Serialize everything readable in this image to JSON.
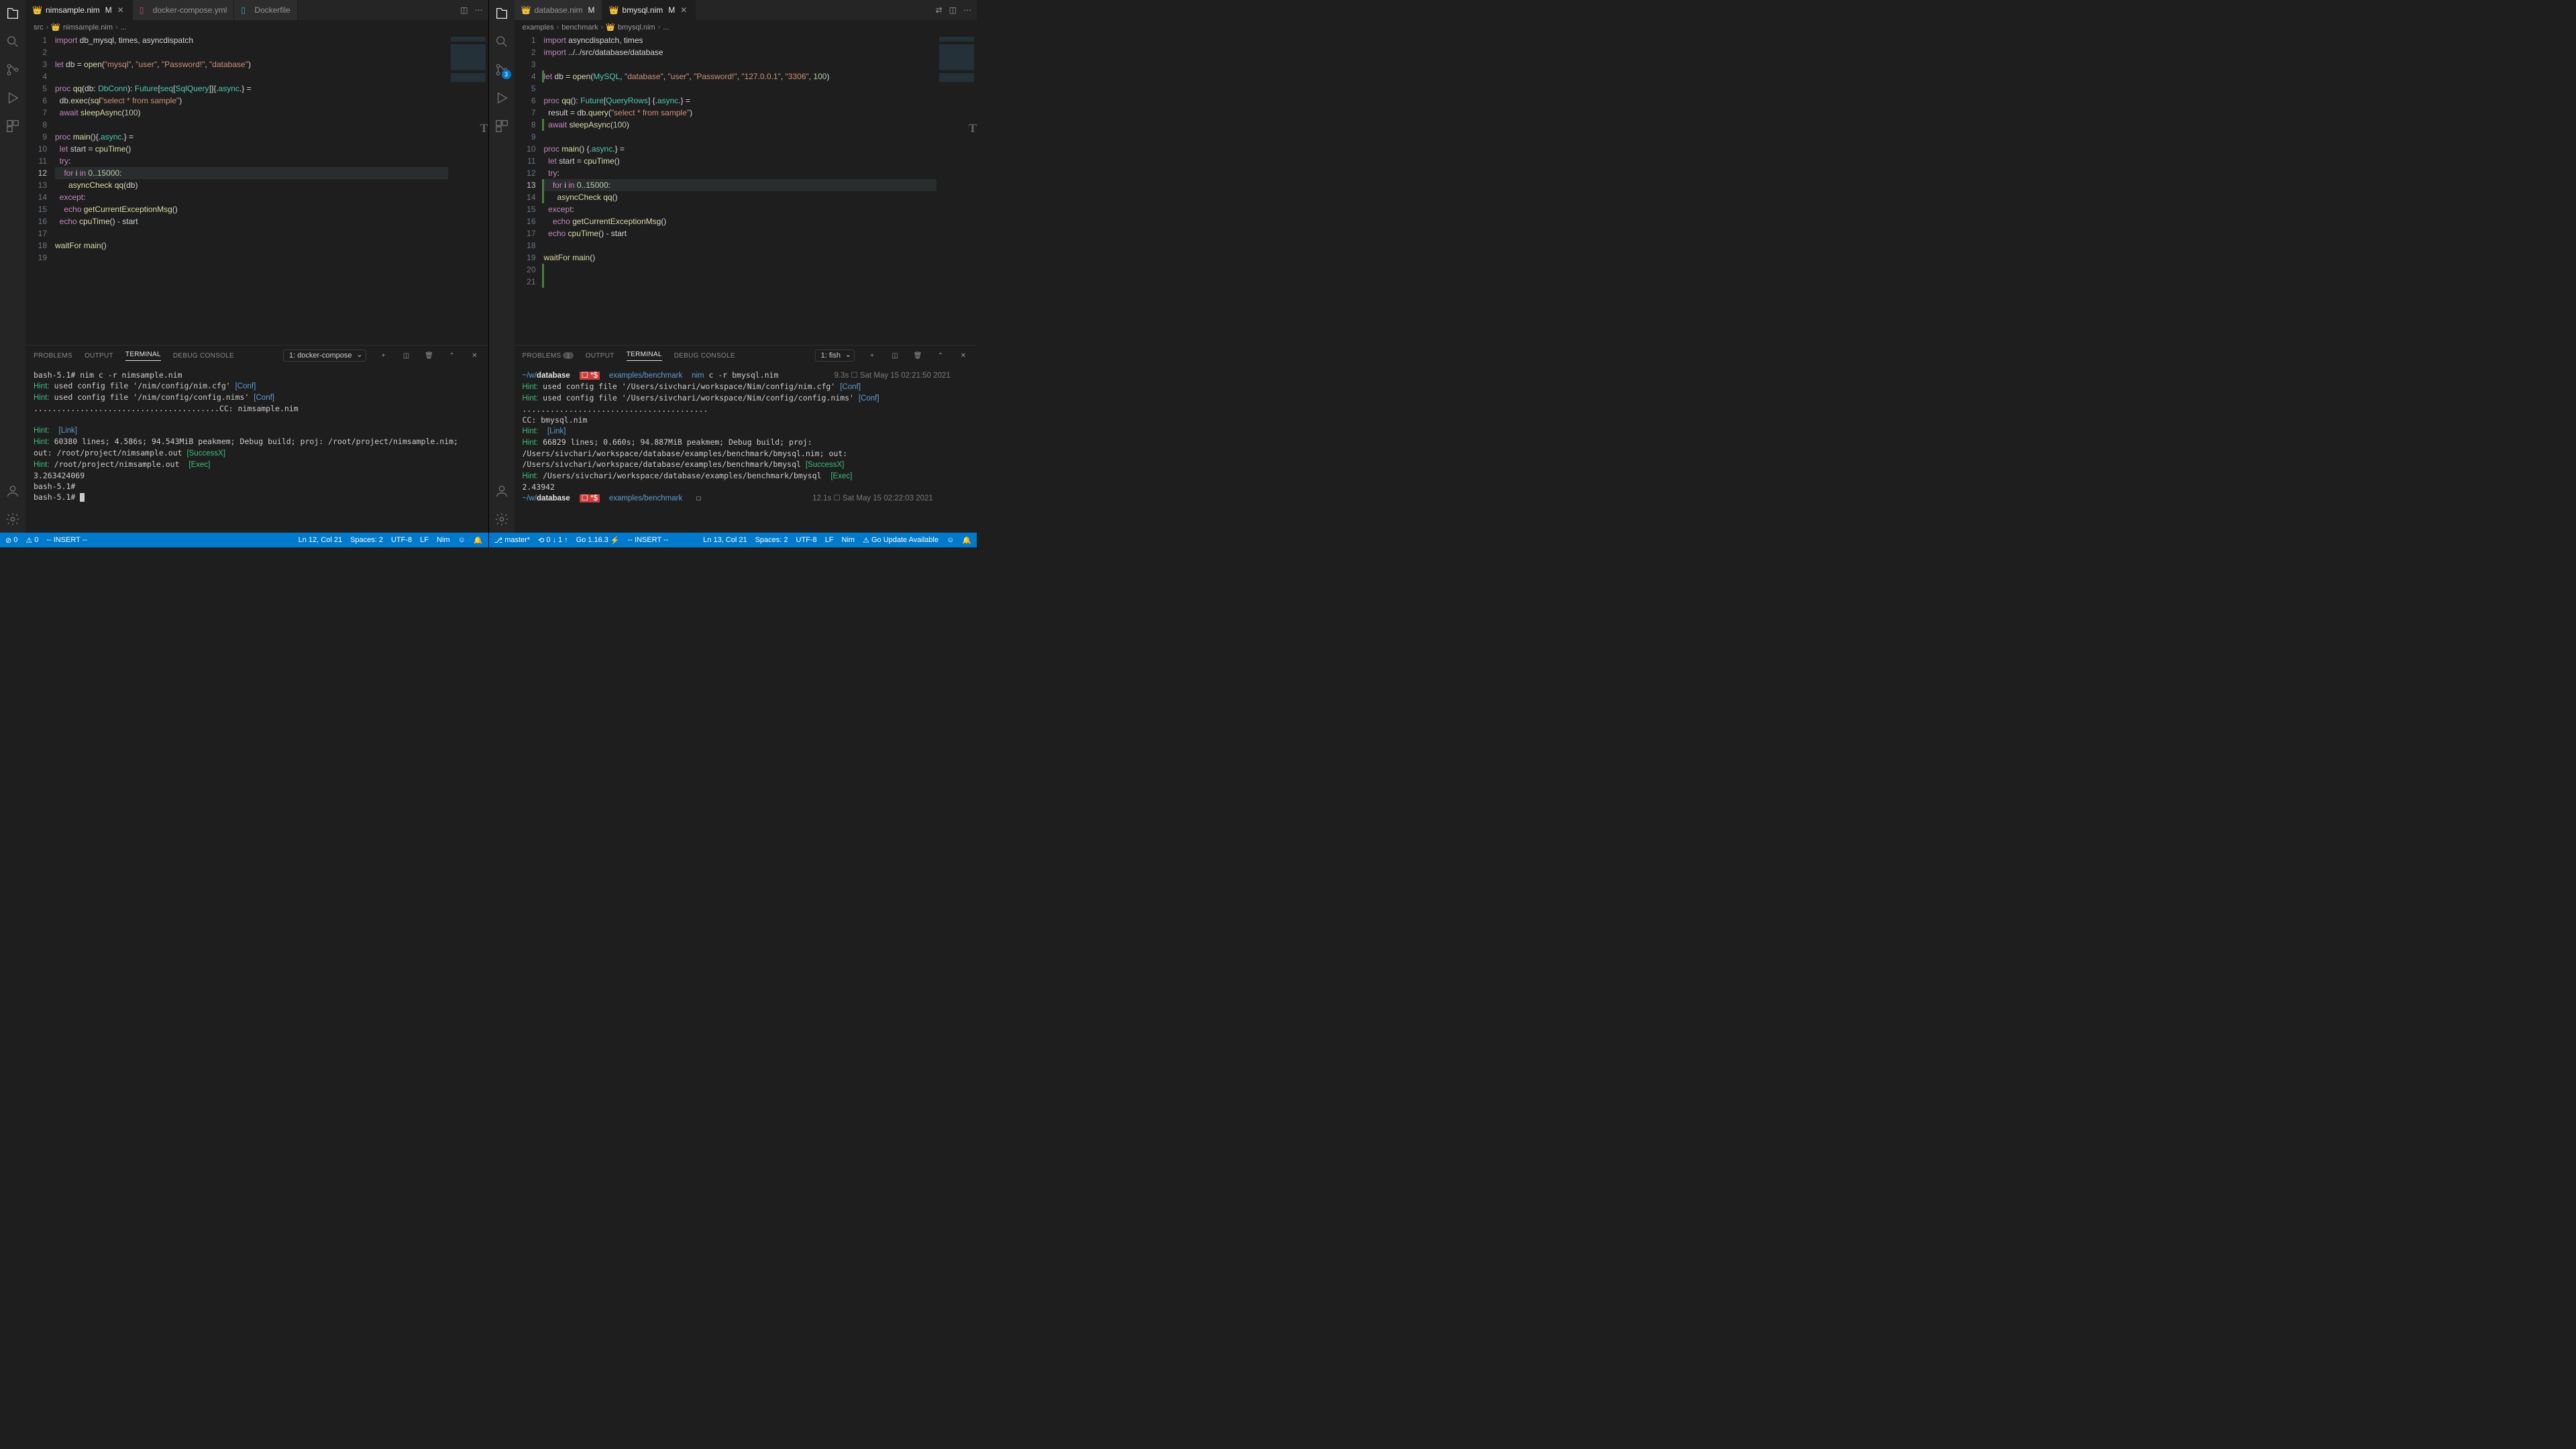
{
  "left": {
    "tabs": [
      {
        "name": "nimsample.nim",
        "status": "M",
        "active": true
      },
      {
        "name": "docker-compose.yml",
        "active": false
      },
      {
        "name": "Dockerfile",
        "active": false
      }
    ],
    "breadcrumb": {
      "a": "src",
      "b": "nimsample.nim",
      "c": "..."
    },
    "code": [
      {
        "n": 1,
        "html": "<span class='kw'>import</span> db_mysql, times, asyncdispatch"
      },
      {
        "n": 2,
        "html": ""
      },
      {
        "n": 3,
        "html": "<span class='kw'>let</span> db = <span class='fn'>open</span>(<span class='st'>\"mysql\"</span>, <span class='st'>\"user\"</span>, <span class='st'>\"Password!\"</span>, <span class='st'>\"database\"</span>)"
      },
      {
        "n": 4,
        "html": ""
      },
      {
        "n": 5,
        "html": "<span class='kw'>proc</span> <span class='fn'>qq</span>(db: <span class='ty'>DbConn</span>): <span class='ty'>Future</span>[<span class='ty'>seq</span>[<span class='ty'>SqlQuery</span>]]{.<span class='ty'>async</span>.} ="
      },
      {
        "n": 6,
        "html": "  db.<span class='fn'>exec</span>(<span class='fn'>sql</span><span class='st'>\"select * from sample\"</span>)"
      },
      {
        "n": 7,
        "html": "  <span class='kw'>await</span> <span class='fn'>sleepAsync</span>(<span class='nm'>100</span>)"
      },
      {
        "n": 8,
        "html": ""
      },
      {
        "n": 9,
        "html": "<span class='kw'>proc</span> <span class='fn'>main</span>(){.<span class='ty'>async</span>.} ="
      },
      {
        "n": 10,
        "html": "  <span class='kw'>let</span> start = <span class='fn'>cpuTime</span>()"
      },
      {
        "n": 11,
        "html": "  <span class='kw'>try</span>:"
      },
      {
        "n": 12,
        "html": "    <span class='kw'>for</span> i <span class='kw'>in</span> <span class='nm'>0</span>..<span class='nm'>15000</span>:",
        "cur": true
      },
      {
        "n": 13,
        "html": "      <span class='fn'>asyncCheck</span> <span class='fn'>qq</span>(db)"
      },
      {
        "n": 14,
        "html": "  <span class='kw'>except</span>:"
      },
      {
        "n": 15,
        "html": "    <span class='kw'>echo</span> <span class='fn'>getCurrentExceptionMsg</span>()"
      },
      {
        "n": 16,
        "html": "  <span class='kw'>echo</span> <span class='fn'>cpuTime</span>() - start"
      },
      {
        "n": 17,
        "html": ""
      },
      {
        "n": 18,
        "html": "<span class='fn'>waitFor</span> <span class='fn'>main</span>()"
      },
      {
        "n": 19,
        "html": ""
      }
    ],
    "panel": {
      "tabs": {
        "problems": "PROBLEMS",
        "output": "OUTPUT",
        "terminal": "TERMINAL",
        "debug": "DEBUG CONSOLE"
      },
      "select": "1: docker-compose",
      "term": "bash-5.1# nim c -r nimsample.nim\n<span class='hint'>Hint:</span> used config file '/nim/config/nim.cfg' <span class='conf'>[Conf]</span>\n<span class='hint'>Hint:</span> used config file '/nim/config/config.nims' <span class='conf'>[Conf]</span>\n........................................CC: nimsample.nim\n\n<span class='hint'>Hint:</span>  <span class='link'>[Link]</span>\n<span class='hint'>Hint:</span> 60380 lines; 4.586s; 94.543MiB peakmem; Debug build; proj: /root/project/nimsample.nim; out: /root/project/nimsample.out <span class='succ'>[SuccessX]</span>\n<span class='hint'>Hint:</span> /root/project/nimsample.out  <span class='exec'>[Exec]</span>\n3.263424069\nbash-5.1#\nbash-5.1# <span class='cursor-block'></span>"
    },
    "status": {
      "errors": "0",
      "warnings": "0",
      "mode": "-- INSERT --",
      "pos": "Ln 12, Col 21",
      "spaces": "Spaces: 2",
      "enc": "UTF-8",
      "eol": "LF",
      "lang": "Nim"
    }
  },
  "right": {
    "scm_badge": "3",
    "tabs": [
      {
        "name": "database.nim",
        "status": "M",
        "active": false
      },
      {
        "name": "bmysql.nim",
        "status": "M",
        "active": true
      }
    ],
    "breadcrumb": {
      "a": "examples",
      "b": "benchmark",
      "c": "bmysql.nim",
      "d": "..."
    },
    "code": [
      {
        "n": 1,
        "html": "<span class='kw'>import</span> asyncdispatch, times"
      },
      {
        "n": 2,
        "html": "<span class='kw'>import</span> ../../src/database/database"
      },
      {
        "n": 3,
        "html": ""
      },
      {
        "n": 4,
        "html": "<span class='kw'>let</span> db = <span class='fn'>open</span>(<span class='ty'>MySQL</span>, <span class='st'>\"database\"</span>, <span class='st'>\"user\"</span>, <span class='st'>\"Password!\"</span>, <span class='st'>\"127.0.0.1\"</span>, <span class='st'>\"3306\"</span>, <span class='nm'>100</span>)",
        "diff": true
      },
      {
        "n": 5,
        "html": ""
      },
      {
        "n": 6,
        "html": "<span class='kw'>proc</span> <span class='fn'>qq</span>(): <span class='ty'>Future</span>[<span class='ty'>QueryRows</span>] {.<span class='ty'>async</span>.} ="
      },
      {
        "n": 7,
        "html": "  result = db.<span class='fn'>query</span>(<span class='st'>\"select * from sample\"</span>)"
      },
      {
        "n": 8,
        "html": "  <span class='kw'>await</span> <span class='fn'>sleepAsync</span>(<span class='nm'>100</span>)",
        "diff": true
      },
      {
        "n": 9,
        "html": ""
      },
      {
        "n": 10,
        "html": "<span class='kw'>proc</span> <span class='fn'>main</span>() {.<span class='ty'>async</span>.} ="
      },
      {
        "n": 11,
        "html": "  <span class='kw'>let</span> start = <span class='fn'>cpuTime</span>()"
      },
      {
        "n": 12,
        "html": "  <span class='kw'>try</span>:"
      },
      {
        "n": 13,
        "html": "    <span class='kw'>for</span> i <span class='kw'>in</span> <span class='nm'>0</span>..<span class='nm'>15000</span>:",
        "cur": true,
        "diff": true
      },
      {
        "n": 14,
        "html": "      <span class='fn'>asyncCheck</span> <span class='fn'>qq</span>()",
        "diff": true
      },
      {
        "n": 15,
        "html": "  <span class='kw'>except</span>:"
      },
      {
        "n": 16,
        "html": "    <span class='kw'>echo</span> <span class='fn'>getCurrentExceptionMsg</span>()"
      },
      {
        "n": 17,
        "html": "  <span class='kw'>echo</span> <span class='fn'>cpuTime</span>() - start"
      },
      {
        "n": 18,
        "html": ""
      },
      {
        "n": 19,
        "html": "<span class='fn'>waitFor</span> <span class='fn'>main</span>()"
      },
      {
        "n": 20,
        "html": "",
        "diff": true
      },
      {
        "n": 21,
        "html": "",
        "diff": true
      }
    ],
    "panel": {
      "tabs": {
        "problems": "PROBLEMS",
        "pcount": "1",
        "output": "OUTPUT",
        "terminal": "TERMINAL",
        "debug": "DEBUG CONSOLE"
      },
      "select": "1: fish",
      "term": "<span class='prpath'>~/w/</span><span class='prbold'>database</span>  <span class='prred'>☐ *$</span>  <span class='prpath'>examples/benchmark</span>  <span style='color:#5f9dd0'>nim</span> c -r bmysql.nim            <span class='prdate'>9.3s ☐ Sat May 15 02:21:50 2021</span>\n<span class='hint'>Hint:</span> used config file '/Users/sivchari/workspace/Nim/config/nim.cfg' <span class='conf'>[Conf]</span>\n<span class='hint'>Hint:</span> used config file '/Users/sivchari/workspace/Nim/config/config.nims' <span class='conf'>[Conf]</span>\n........................................\nCC: bmysql.nim\n<span class='hint'>Hint:</span>  <span class='link'>[Link]</span>\n<span class='hint'>Hint:</span> 66829 lines; 0.660s; 94.887MiB peakmem; Debug build; proj: /Users/sivchari/workspace/database/examples/benchmark/bmysql.nim; out: /Users/sivchari/workspace/database/examples/benchmark/bmysql <span class='succ'>[SuccessX]</span>\n<span class='hint'>Hint:</span> /Users/sivchari/workspace/database/examples/benchmark/bmysql  <span class='exec'>[Exec]</span>\n2.43942\n<span class='prpath'>~/w/</span><span class='prbold'>database</span>  <span class='prred'>☐ *$</span>  <span class='prpath'>examples/benchmark</span>   ☐                        <span class='prdate'>12.1s ☐ Sat May 15 02:22:03 2021</span>"
    },
    "status": {
      "branch": "master*",
      "sync1": "0",
      "sync2": "1",
      "go": "Go 1.16.3",
      "mode": "-- INSERT --",
      "pos": "Ln 13, Col 21",
      "spaces": "Spaces: 2",
      "enc": "UTF-8",
      "eol": "LF",
      "lang": "Nim",
      "update": "Go Update Available"
    }
  }
}
